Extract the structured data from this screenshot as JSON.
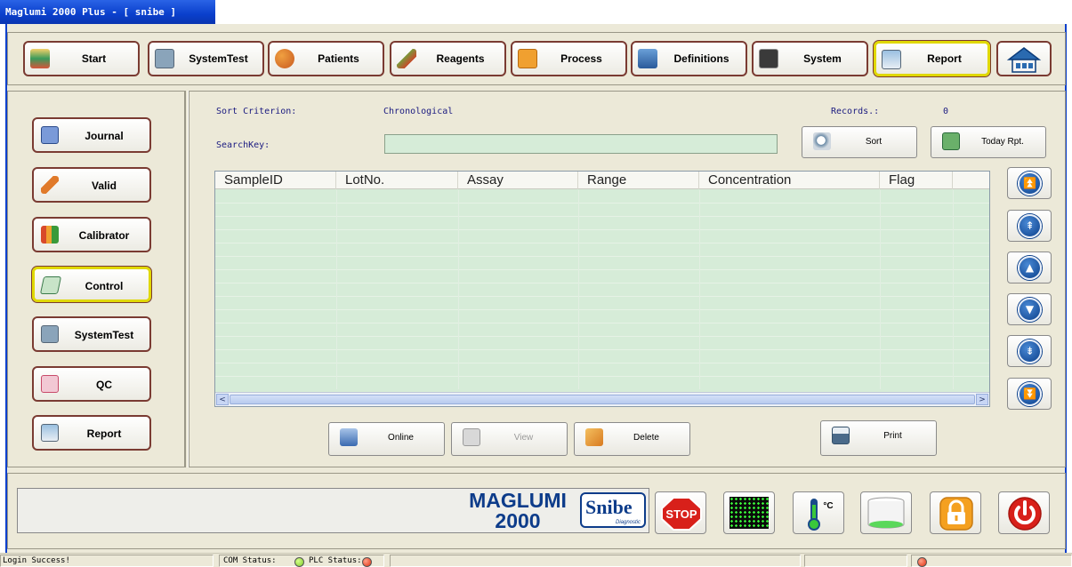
{
  "window": {
    "title": "Maglumi 2000 Plus - [ snibe ]"
  },
  "nav": {
    "items": [
      {
        "label": "Start",
        "icon": "start-icon",
        "color": "#d9a23a"
      },
      {
        "label": "SystemTest",
        "icon": "systemtest-icon",
        "color": "#6a8aa6"
      },
      {
        "label": "Patients",
        "icon": "patients-icon",
        "color": "#d88a3a"
      },
      {
        "label": "Reagents",
        "icon": "reagents-icon",
        "color": "#7a9a3a"
      },
      {
        "label": "Process",
        "icon": "process-icon",
        "color": "#e89a2a"
      },
      {
        "label": "Definitions",
        "icon": "definitions-icon",
        "color": "#4a86c6"
      },
      {
        "label": "System",
        "icon": "system-icon",
        "color": "#555555"
      },
      {
        "label": "Report",
        "icon": "report-icon",
        "color": "#6a9ac6",
        "active": true
      }
    ],
    "home_icon": "home-icon"
  },
  "sidebar": {
    "items": [
      {
        "label": "Journal",
        "icon": "journal-icon",
        "color": "#6a8ac6"
      },
      {
        "label": "Valid",
        "icon": "valid-icon",
        "color": "#e07a2a"
      },
      {
        "label": "Calibrator",
        "icon": "calibrator-icon",
        "color": "#d84a2a"
      },
      {
        "label": "Control",
        "icon": "control-icon",
        "color": "#5aa06a",
        "active": true
      },
      {
        "label": "SystemTest",
        "icon": "systemtest-icon",
        "color": "#6a8aa6"
      },
      {
        "label": "QC",
        "icon": "qc-icon",
        "color": "#d84a6a"
      },
      {
        "label": "Report",
        "icon": "report-icon",
        "color": "#6a9ac6"
      }
    ]
  },
  "main": {
    "sort_criterion_label": "Sort Criterion:",
    "sort_criterion_value": "Chronological",
    "records_label": "Records.:",
    "records_value": "0",
    "searchkey_label": "SearchKey:",
    "search_value": "",
    "sort_button": "Sort",
    "today_button": "Today Rpt.",
    "columns": [
      "SampleID",
      "LotNo.",
      "Assay",
      "Range",
      "Concentration",
      "Flag"
    ],
    "rows": [],
    "online_button": "Online",
    "view_button": "View",
    "delete_button": "Delete",
    "print_button": "Print"
  },
  "scroll_buttons": [
    {
      "name": "scroll-top-button",
      "glyph": "⏫"
    },
    {
      "name": "scroll-page-up-button",
      "glyph": "⇞"
    },
    {
      "name": "scroll-up-button",
      "glyph": "▲"
    },
    {
      "name": "scroll-down-button",
      "glyph": "▼"
    },
    {
      "name": "scroll-page-down-button",
      "glyph": "⇟"
    },
    {
      "name": "scroll-bottom-button",
      "glyph": "⏬"
    }
  ],
  "brand": {
    "line1": "MAGLUMI",
    "line2": "2000",
    "logo": "Snibe",
    "logo_sub": "Diagnostic"
  },
  "bottom_buttons": {
    "stop": "STOP",
    "temp_unit": "°C"
  },
  "statusbar": {
    "message": "Login Success!",
    "com_status_label": "COM Status:",
    "plc_status_label": "PLC Status:",
    "com_status_color": "#7acb2a",
    "plc_status_color": "#e03010",
    "alarm_color": "#e03010"
  }
}
